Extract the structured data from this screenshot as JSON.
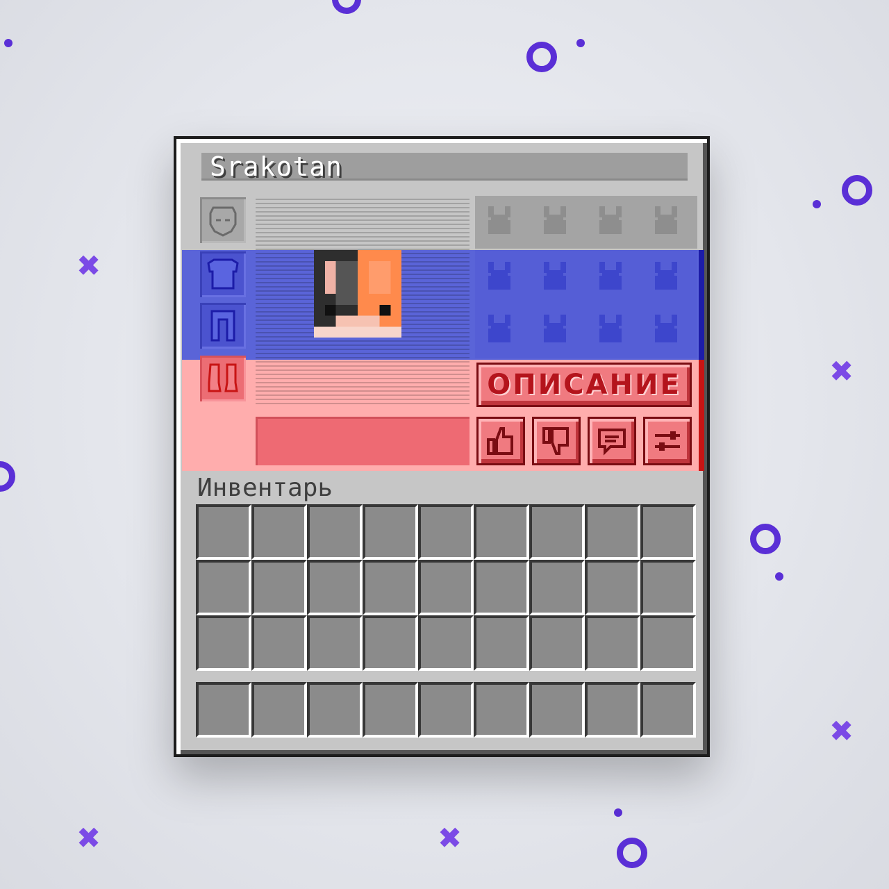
{
  "window": {
    "player_name": "Srakotan",
    "inventory_label": "Инвентарь",
    "description_button": "ОПИСАНИЕ"
  },
  "equipment_slots": [
    {
      "name": "helmet",
      "icon": "helmet-icon"
    },
    {
      "name": "chestplate",
      "icon": "chestplate-icon"
    },
    {
      "name": "leggings",
      "icon": "leggings-icon"
    },
    {
      "name": "boots",
      "icon": "boots-icon"
    }
  ],
  "action_buttons": [
    {
      "name": "like",
      "icon": "thumbs-up-icon"
    },
    {
      "name": "dislike",
      "icon": "thumbs-down-icon"
    },
    {
      "name": "comment",
      "icon": "chat-icon"
    },
    {
      "name": "settings",
      "icon": "sliders-icon"
    }
  ],
  "inventory": {
    "main_rows": 3,
    "hotbar_rows": 1,
    "columns": 9
  },
  "colors": {
    "accent": "#5a2fd6",
    "band_blue": "#5a64d8",
    "band_red": "#ffadad",
    "button_red": "#f07a80"
  }
}
